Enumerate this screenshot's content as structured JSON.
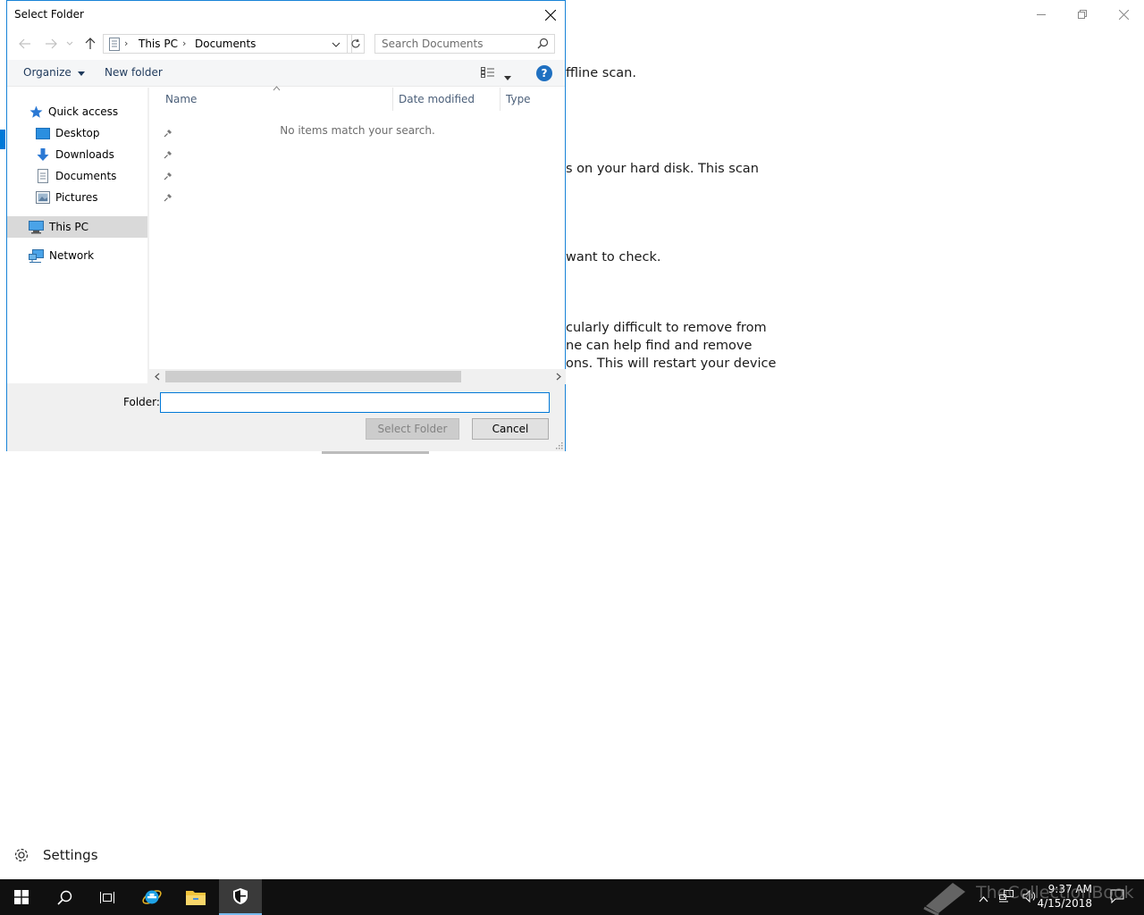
{
  "background_window": {
    "text_lines": [
      "ffline scan.",
      "s on your hard disk. This scan",
      "want to check.",
      "cularly difficult to remove from",
      "ne can help find and remove",
      "ons. This will restart your device"
    ],
    "settings_label": "Settings"
  },
  "dialog": {
    "title": "Select Folder",
    "breadcrumb": [
      "This PC",
      "Documents"
    ],
    "search_placeholder": "Search Documents",
    "toolbar": {
      "organize": "Organize",
      "new_folder": "New folder"
    },
    "help_glyph": "?",
    "nav": {
      "quick_access": "Quick access",
      "pinned": [
        "Desktop",
        "Downloads",
        "Documents",
        "Pictures"
      ],
      "this_pc": "This PC",
      "network": "Network"
    },
    "columns": [
      "Name",
      "Date modified",
      "Type"
    ],
    "empty_message": "No items match your search.",
    "folder_label": "Folder:",
    "folder_value": "",
    "select_button": "Select Folder",
    "cancel_button": "Cancel"
  },
  "taskbar": {
    "time": "9:37 AM",
    "date": "4/15/2018",
    "watermark": "TheCollectionBook"
  },
  "colors": {
    "accent": "#0078d7",
    "taskbar": "#101010"
  }
}
